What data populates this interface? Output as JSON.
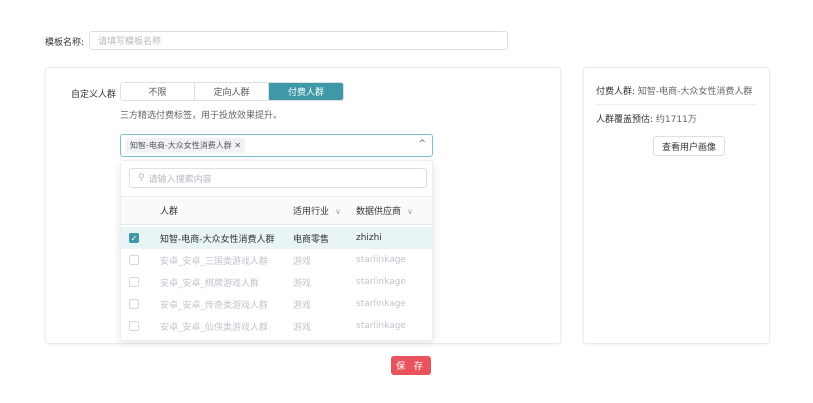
{
  "template_name": {
    "label": "模板名称:",
    "placeholder": "请填写模板名称"
  },
  "audience": {
    "label": "自定义人群",
    "segments": [
      {
        "label": "不限"
      },
      {
        "label": "定向人群"
      },
      {
        "label": "付费人群"
      }
    ],
    "selected_segment": "付费人群",
    "hint": "三方精选付费标签，用于投放效果提升。",
    "selected_tag": "知智-电商-大众女性消费人群",
    "dropdown": {
      "search_placeholder": "请输入搜索内容",
      "columns": [
        "人群",
        "适用行业",
        "数据供应商"
      ],
      "rows": [
        {
          "name": "知智-电商-大众女性消费人群",
          "industry": "电商零售",
          "vendor": "zhizhi",
          "checked": true,
          "disabled": false
        },
        {
          "name": "安卓_安卓_三国类游戏人群",
          "industry": "游戏",
          "vendor": "starlinkage",
          "checked": false,
          "disabled": true
        },
        {
          "name": "安卓_安卓_棋牌游戏人群",
          "industry": "游戏",
          "vendor": "starlinkage",
          "checked": false,
          "disabled": true
        },
        {
          "name": "安卓_安卓_传奇类游戏人群",
          "industry": "游戏",
          "vendor": "starlinkage",
          "checked": false,
          "disabled": true
        },
        {
          "name": "安卓_安卓_仙侠类游戏人群",
          "industry": "游戏",
          "vendor": "starlinkage",
          "checked": false,
          "disabled": true
        }
      ]
    }
  },
  "summary": {
    "paid_label": "付费人群:",
    "paid_value": "知智-电商-大众女性消费人群",
    "coverage_label": "人群覆盖预估:",
    "coverage_value": "约1711万",
    "portrait_button": "查看用户画像"
  },
  "save_button": "保 存",
  "colors": {
    "accent": "#3f98a8",
    "save": "#e9535d"
  }
}
